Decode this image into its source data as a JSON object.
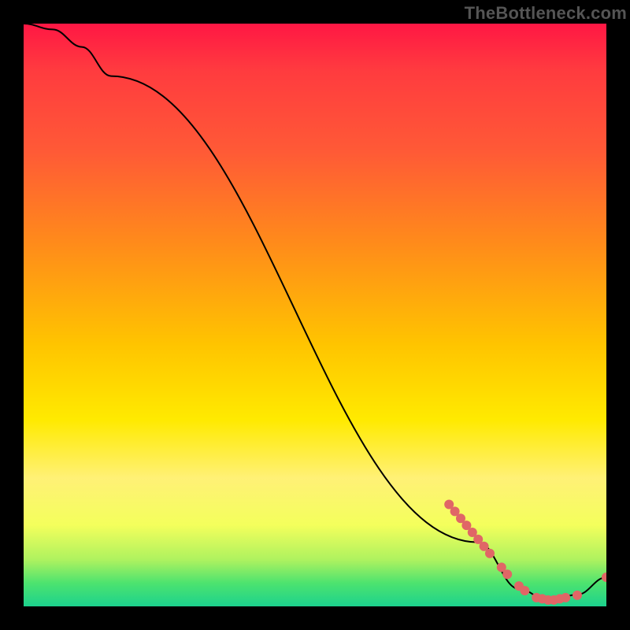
{
  "watermark": "TheBottleneck.com",
  "chart_data": {
    "type": "line",
    "title": "",
    "xlabel": "",
    "ylabel": "",
    "xlim": [
      0,
      100
    ],
    "ylim": [
      0,
      100
    ],
    "grid": false,
    "legend": false,
    "curve": {
      "x": [
        0,
        5,
        10,
        15,
        78,
        85,
        90,
        95,
        100
      ],
      "y": [
        100,
        99,
        96,
        91,
        11,
        3,
        1,
        2,
        5
      ]
    },
    "marker_series": {
      "name": "highlighted-range",
      "color": "#e06666",
      "radius": 6,
      "points": [
        {
          "x": 73,
          "y": 17.5
        },
        {
          "x": 74,
          "y": 16.3
        },
        {
          "x": 75,
          "y": 15.1
        },
        {
          "x": 76,
          "y": 13.9
        },
        {
          "x": 77,
          "y": 12.7
        },
        {
          "x": 78,
          "y": 11.5
        },
        {
          "x": 79,
          "y": 10.3
        },
        {
          "x": 80,
          "y": 9.1
        },
        {
          "x": 82,
          "y": 6.7
        },
        {
          "x": 83,
          "y": 5.5
        },
        {
          "x": 85,
          "y": 3.5
        },
        {
          "x": 86,
          "y": 2.7
        },
        {
          "x": 88,
          "y": 1.5
        },
        {
          "x": 89,
          "y": 1.3
        },
        {
          "x": 90,
          "y": 1.1
        },
        {
          "x": 91,
          "y": 1.1
        },
        {
          "x": 92,
          "y": 1.3
        },
        {
          "x": 93,
          "y": 1.5
        },
        {
          "x": 95,
          "y": 1.9
        },
        {
          "x": 100,
          "y": 5.0
        }
      ]
    }
  }
}
